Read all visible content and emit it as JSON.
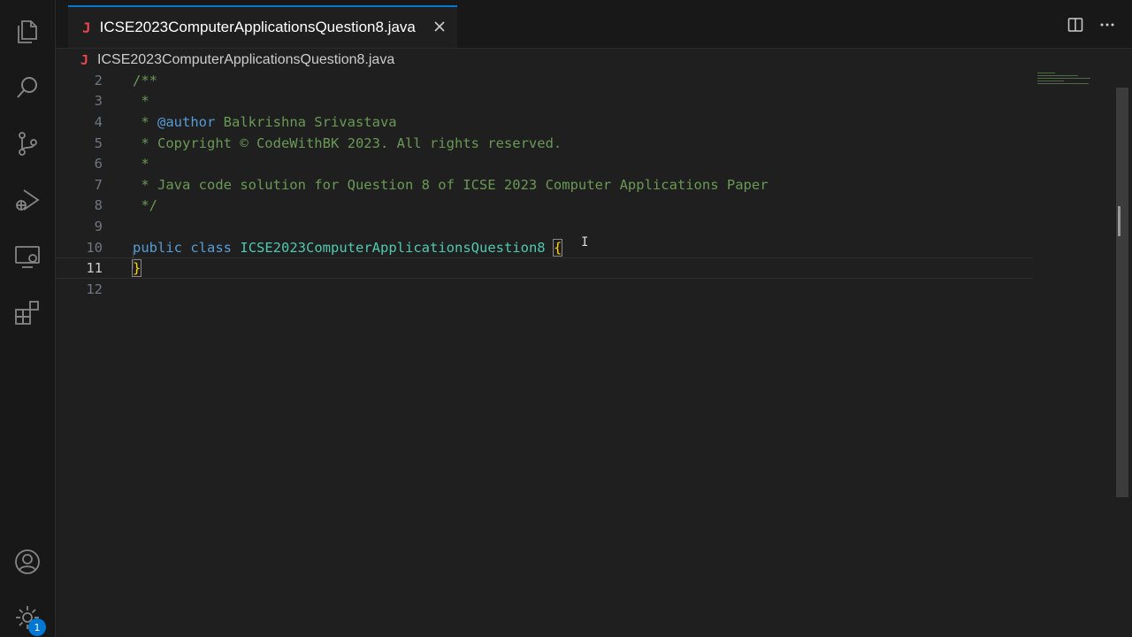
{
  "tab": {
    "file_icon": "J",
    "name": "ICSE2023ComputerApplicationsQuestion8.java",
    "close_icon": "close-icon"
  },
  "breadcrumb": {
    "file_icon": "J",
    "name": "ICSE2023ComputerApplicationsQuestion8.java"
  },
  "activity_bar": {
    "icons": [
      "explorer-icon",
      "search-icon",
      "source-control-icon",
      "run-debug-icon",
      "remote-explorer-icon",
      "extensions-icon",
      "accounts-icon",
      "manage-gear-icon"
    ],
    "badge": "1"
  },
  "editor_actions": [
    "split-editor-icon",
    "more-actions-icon"
  ],
  "editor": {
    "current_line": "11",
    "lines": [
      {
        "n": "2",
        "comment": "/**"
      },
      {
        "n": "3",
        "comment": " *"
      },
      {
        "n": "4",
        "comment_pre": " * ",
        "tag": "@author",
        "comment": " Balkrishna Srivastava"
      },
      {
        "n": "5",
        "comment": " * Copyright © CodeWithBK 2023. All rights reserved."
      },
      {
        "n": "6",
        "comment": " *"
      },
      {
        "n": "7",
        "comment": " * Java code solution for Question 8 of ICSE 2023 Computer Applications Paper"
      },
      {
        "n": "8",
        "comment": " */"
      },
      {
        "n": "9"
      },
      {
        "n": "10",
        "kw1": "public",
        "kw2": "class",
        "cls": "ICSE2023ComputerApplicationsQuestion8",
        "brace": "{"
      },
      {
        "n": "11",
        "brace": "}"
      },
      {
        "n": "12"
      }
    ]
  },
  "colors": {
    "accent": "#0078d4",
    "java_icon": "#e5464b",
    "comment": "#6a9955",
    "keyword": "#569cd6",
    "class": "#4ec9b0",
    "brace": "#ffd700"
  }
}
